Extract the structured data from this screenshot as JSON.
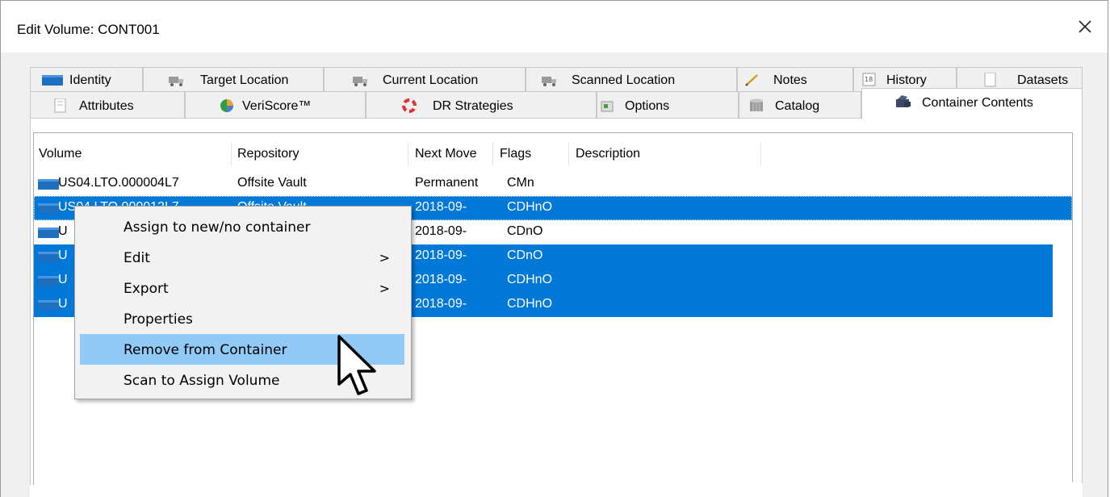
{
  "window": {
    "title": "Edit Volume: CONT001",
    "close_label": "×"
  },
  "tabs_row1": [
    {
      "label": "Identity",
      "icon": "tape-volume-icon"
    },
    {
      "label": "Target Location",
      "icon": "truck-icon"
    },
    {
      "label": "Current Location",
      "icon": "truck-icon"
    },
    {
      "label": "Scanned Location",
      "icon": "truck-icon"
    },
    {
      "label": "Notes",
      "icon": "pencil-icon"
    },
    {
      "label": "History",
      "icon": "calendar-icon"
    },
    {
      "label": "Datasets",
      "icon": "document-icon"
    }
  ],
  "tabs_row2": [
    {
      "label": "Attributes",
      "icon": "document-icon"
    },
    {
      "label": "VeriScore™",
      "icon": "pie-chart-icon"
    },
    {
      "label": "DR Strategies",
      "icon": "life-ring-icon"
    },
    {
      "label": "Options",
      "icon": "options-icon"
    },
    {
      "label": "Catalog",
      "icon": "database-icon"
    },
    {
      "label": "Container Contents",
      "icon": "container-icon",
      "active": true
    }
  ],
  "list": {
    "columns": [
      "Volume",
      "Repository",
      "Next Move",
      "Flags",
      "Description"
    ],
    "rows": [
      {
        "volume": "US04.LTO.000004L7",
        "repository": "Offsite Vault",
        "next_move": "Permanent",
        "flags": "CMn",
        "description": "",
        "selected": false
      },
      {
        "volume": "US04.LTO.000012L7",
        "repository": "Offsite Vault",
        "next_move": "2018-09-",
        "flags": "CDHnO",
        "description": "",
        "selected": true
      },
      {
        "volume": "U",
        "repository": "",
        "next_move": "2018-09-",
        "flags": "CDnO",
        "description": "",
        "selected": false
      },
      {
        "volume": "U",
        "repository": "",
        "next_move": "2018-09-",
        "flags": "CDnO",
        "description": "",
        "selected": true
      },
      {
        "volume": "U",
        "repository": "",
        "next_move": "2018-09-",
        "flags": "CDHnO",
        "description": "",
        "selected": true
      },
      {
        "volume": "U",
        "repository": "",
        "next_move": "2018-09-",
        "flags": "CDHnO",
        "description": "",
        "selected": true
      }
    ]
  },
  "context_menu": {
    "items": [
      {
        "label": "Assign to new/no container",
        "submenu": false
      },
      {
        "label": "Edit",
        "submenu": true
      },
      {
        "label": "Export",
        "submenu": true
      },
      {
        "label": "Properties",
        "submenu": false
      },
      {
        "label": "Remove from Container",
        "submenu": false,
        "highlighted": true
      },
      {
        "label": "Scan to Assign Volume",
        "submenu": false
      }
    ],
    "submenu_arrow": ">"
  },
  "colors": {
    "selection": "#0078d7",
    "menu_highlight": "#91c9f7",
    "volume_icon": "#1e6fc0"
  }
}
